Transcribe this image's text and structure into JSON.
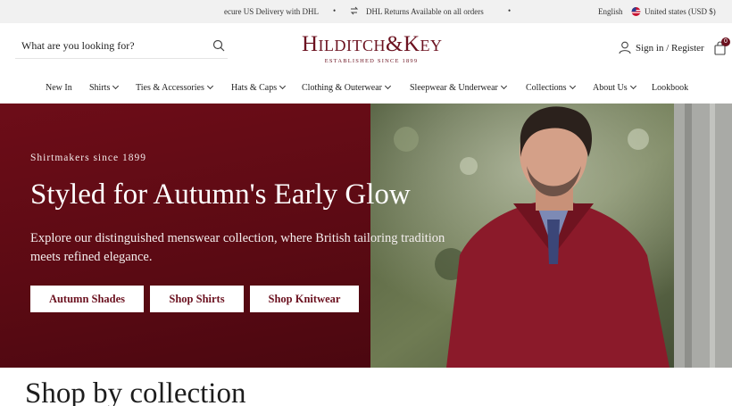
{
  "announcement": {
    "delivery_text": "ecure US Delivery with DHL",
    "returns_text": "DHL Returns Available on all orders",
    "separator": "•",
    "language": "English",
    "currency": "United states (USD $)",
    "returns_icon": "return-arrow-icon",
    "flag_icon": "us-flag-icon"
  },
  "header": {
    "search_placeholder": "What are you looking for?",
    "logo_text": "Hilditch&Key",
    "logo_tagline": "ESTABLISHED SINCE 1899",
    "account_label": "Sign in / Register",
    "cart_count": "0",
    "brand_color": "#6c1220"
  },
  "nav": {
    "items": [
      {
        "label": "New In",
        "dropdown": false
      },
      {
        "label": "Shirts",
        "dropdown": true
      },
      {
        "label": "Ties & Accessories",
        "dropdown": true
      },
      {
        "label": "Hats & Caps",
        "dropdown": true
      },
      {
        "label": "Clothing & Outerwear",
        "dropdown": true
      },
      {
        "label": "Sleepwear & Underwear",
        "dropdown": true
      },
      {
        "label": "Collections",
        "dropdown": true
      },
      {
        "label": "About Us",
        "dropdown": true
      },
      {
        "label": "Lookbook",
        "dropdown": false
      }
    ]
  },
  "hero": {
    "eyebrow": "Shirtmakers since 1899",
    "headline": "Styled for Autumn's Early Glow",
    "subtext": "Explore our distinguished menswear collection, where British tailoring tradition meets refined elegance.",
    "buttons": [
      "Autumn Shades",
      "Shop Shirts",
      "Shop Knitwear"
    ],
    "panel_color": "#6d0d18"
  },
  "section": {
    "title": "Shop by collection"
  }
}
